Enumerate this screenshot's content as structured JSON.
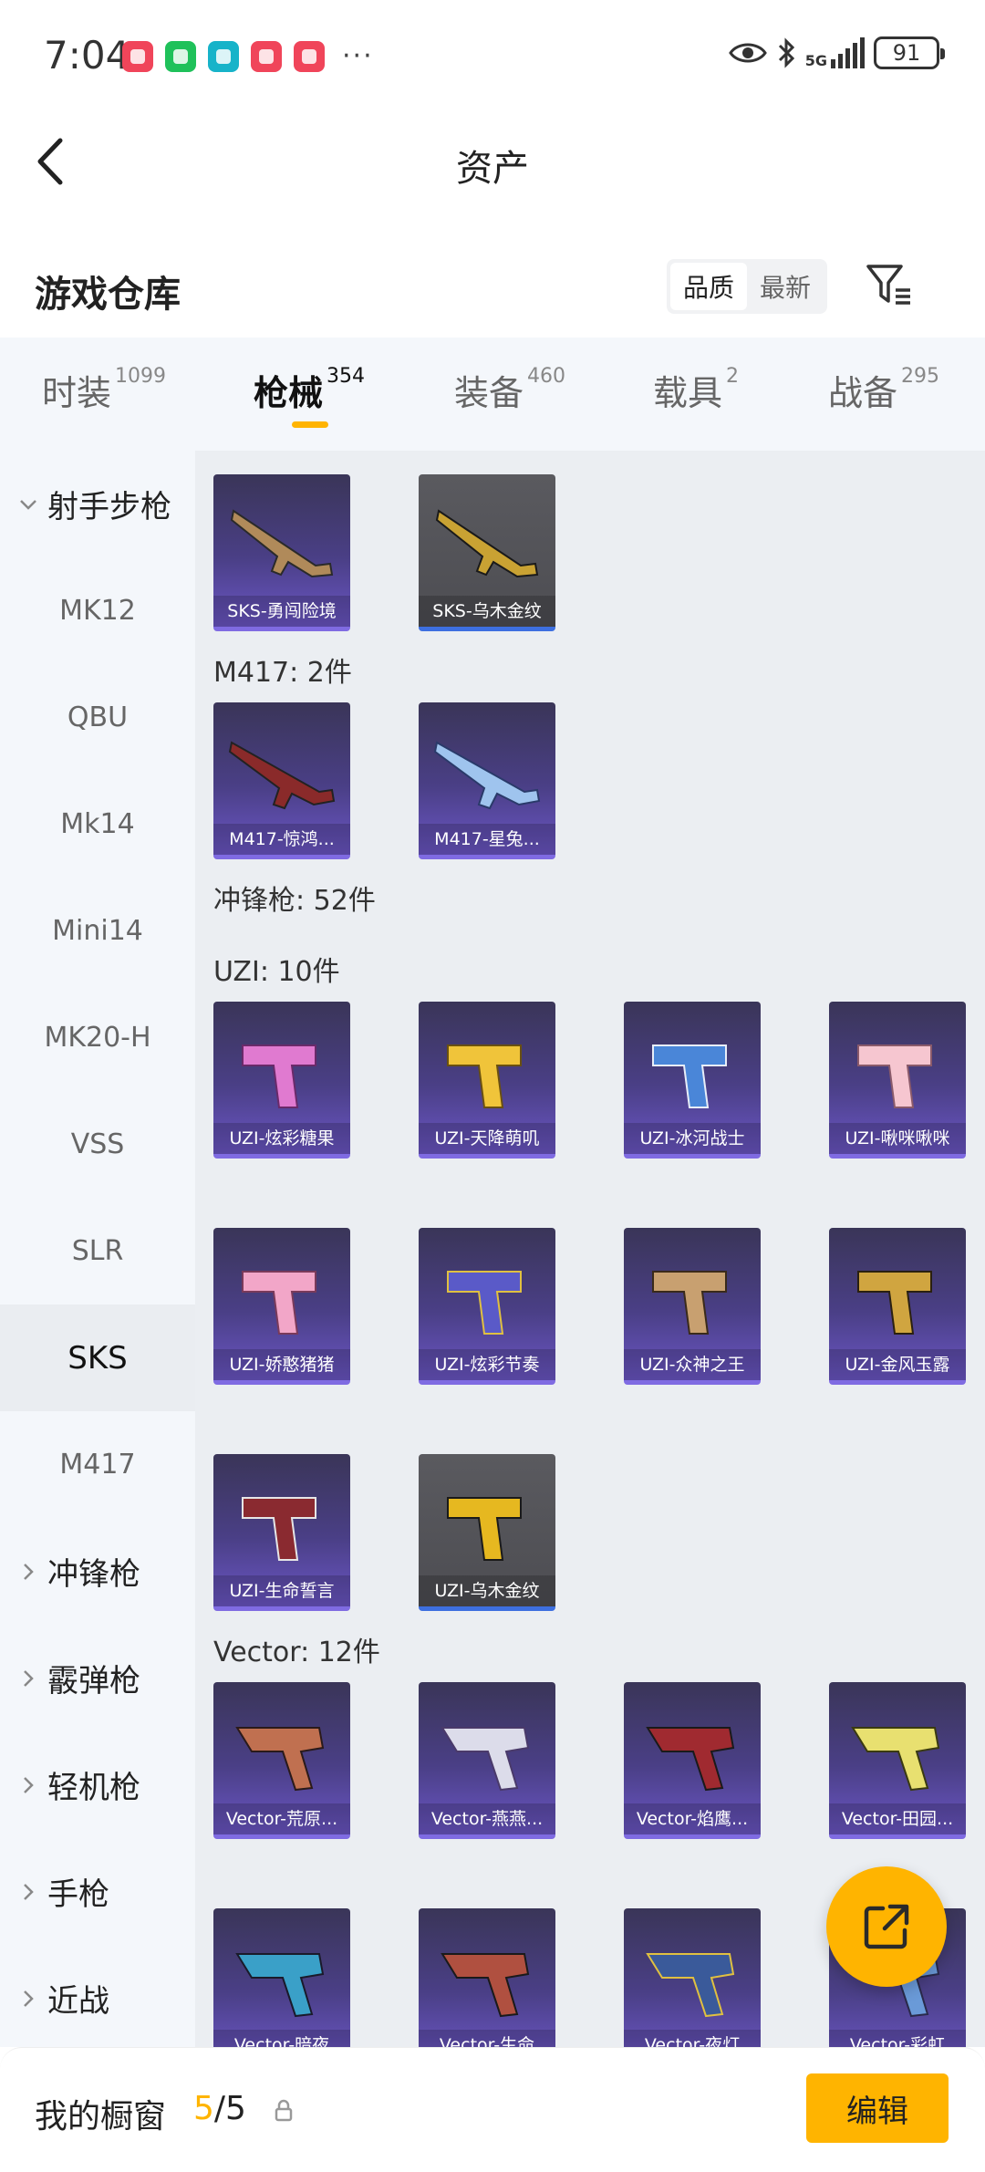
{
  "status_bar": {
    "time": "7:04",
    "network": "5G",
    "battery": "91",
    "notification_icons": [
      "red-shop-icon",
      "wechat-icon",
      "shield-icon",
      "red-shop-icon",
      "red-shop-icon"
    ],
    "more": "···"
  },
  "header": {
    "title": "资产"
  },
  "inventory": {
    "title": "游戏仓库",
    "sort_options": [
      "品质",
      "最新"
    ],
    "active_sort": "品质"
  },
  "tabs": [
    {
      "label": "时装",
      "count": "1099"
    },
    {
      "label": "枪械",
      "count": "354"
    },
    {
      "label": "装备",
      "count": "460"
    },
    {
      "label": "载具",
      "count": "2"
    },
    {
      "label": "战备",
      "count": "295"
    }
  ],
  "active_tab": "枪械",
  "sidebar": {
    "items": [
      {
        "label": "射手步枪",
        "group": true,
        "expanded": true
      },
      {
        "label": "MK12"
      },
      {
        "label": "QBU"
      },
      {
        "label": "Mk14"
      },
      {
        "label": "Mini14"
      },
      {
        "label": "MK20-H"
      },
      {
        "label": "VSS"
      },
      {
        "label": "SLR"
      },
      {
        "label": "SKS",
        "active": true
      },
      {
        "label": "M417"
      },
      {
        "label": "冲锋枪",
        "group": true
      },
      {
        "label": "霰弹枪",
        "group": true
      },
      {
        "label": "轻机枪",
        "group": true
      },
      {
        "label": "手枪",
        "group": true
      },
      {
        "label": "近战",
        "group": true
      }
    ]
  },
  "content": {
    "sks_items": [
      "SKS-勇闯险境",
      "SKS-乌木金纹"
    ],
    "m417_label": "M417: 2件",
    "m417_items": [
      "M417-惊鸿...",
      "M417-星兔..."
    ],
    "smg_label": "冲锋枪: 52件",
    "uzi_label": "UZI: 10件",
    "uzi_items": [
      "UZI-炫彩糖果",
      "UZI-天降萌叽",
      "UZI-冰河战士",
      "UZI-啾咪啾咪",
      "UZI-娇憨猪猪",
      "UZI-炫彩节奏",
      "UZI-众神之王",
      "UZI-金风玉露",
      "UZI-生命誓言",
      "UZI-乌木金纹"
    ],
    "vector_label": "Vector: 12件",
    "vector_items": [
      "Vector-荒原...",
      "Vector-燕燕...",
      "Vector-焰鹰...",
      "Vector-田园...",
      "Vector-暗夜",
      "Vector-生命",
      "Vector-夜灯",
      "Vector-彩虹"
    ]
  },
  "bottom": {
    "showcase_label": "我的橱窗",
    "current": "5",
    "total": "/5",
    "edit_label": "编辑"
  },
  "colors": {
    "accent": "#ffb400",
    "card_purple": "#4a3f86",
    "card_gray": "#4d4d52"
  }
}
